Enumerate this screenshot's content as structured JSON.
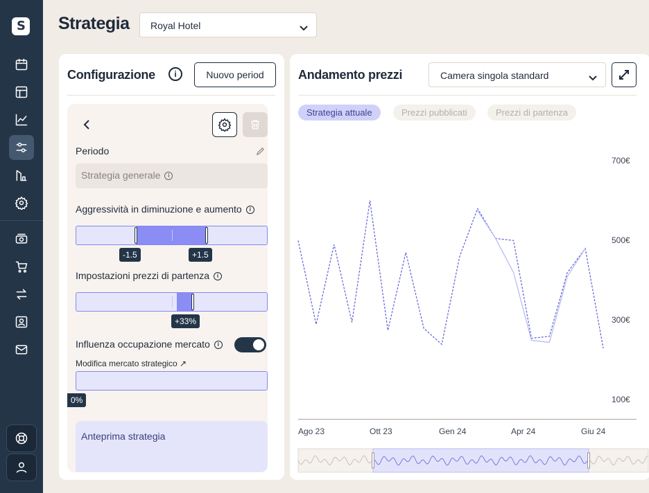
{
  "header": {
    "title": "Strategia",
    "hotel": "Royal Hotel"
  },
  "config": {
    "title": "Configurazione",
    "info_glyph": "i",
    "new_period_label": "Nuovo period",
    "period_label": "Periodo",
    "strategy_value": "Strategia generale",
    "aggressiveness_label": "Aggressività in diminuzione e aumento",
    "aggr_min": -1.5,
    "aggr_max": 1.5,
    "aggr_min_label": "-1.5",
    "aggr_max_label": "+1.5",
    "start_price_label": "Impostazioni prezzi di partenza",
    "start_price": 33,
    "start_price_label_val": "+33%",
    "market_label": "Influenza occupazione mercato",
    "market_toggle": true,
    "market_link": "Modifica mercato strategico ↗",
    "market_value": 0,
    "market_value_label": "0%",
    "preview_label": "Anteprima strategia"
  },
  "chart_panel": {
    "title": "Andamento prezzi",
    "room": "Camera singola standard",
    "tabs": [
      {
        "label": "Strategia attuale",
        "active": true
      },
      {
        "label": "Prezzi pubblicati",
        "active": false
      },
      {
        "label": "Prezzi di partenza",
        "active": false
      }
    ]
  },
  "chart_data": {
    "type": "line",
    "x_labels": [
      "Ago 23",
      "Ott 23",
      "Gen 24",
      "Apr 24",
      "Giu 24"
    ],
    "y_ticks": [
      "700€",
      "500€",
      "300€",
      "100€"
    ],
    "ylim": [
      100,
      700
    ],
    "series": [
      {
        "style": "dashed",
        "color": "#5b5fd6",
        "values": [
          500,
          290,
          490,
          295,
          600,
          275,
          470,
          280,
          240,
          460,
          580,
          505,
          500,
          255,
          260,
          420,
          480,
          230
        ]
      },
      {
        "style": "solid",
        "color": "#b8baf5",
        "values": [
          null,
          null,
          null,
          null,
          null,
          null,
          null,
          null,
          null,
          null,
          575,
          505,
          420,
          250,
          245,
          410,
          480,
          null
        ]
      }
    ]
  }
}
